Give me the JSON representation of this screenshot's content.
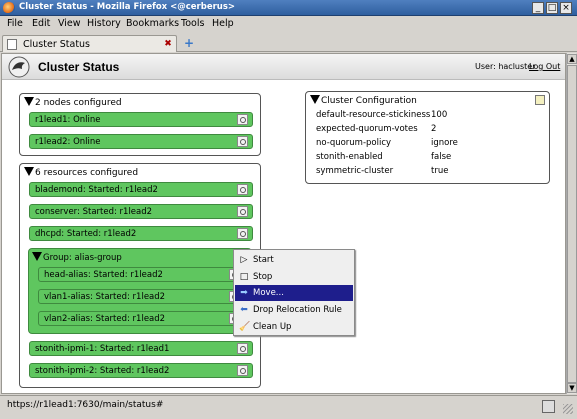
{
  "window": {
    "title": "Cluster Status - Mozilla Firefox <@cerberus>"
  },
  "menubar": {
    "items": [
      "File",
      "Edit",
      "View",
      "History",
      "Bookmarks",
      "Tools",
      "Help"
    ]
  },
  "tab": {
    "label": "Cluster Status",
    "new_tab_icon": "plus-icon"
  },
  "header": {
    "title": "Cluster Status",
    "user_text": "User: hacluster",
    "logout": "Log Out"
  },
  "nodes_panel": {
    "title": "2 nodes configured",
    "items": [
      {
        "label": "r1lead1: Online"
      },
      {
        "label": "r1lead2: Online"
      }
    ]
  },
  "resources_panel": {
    "title": "6 resources configured",
    "items": [
      {
        "label": "blademond: Started: r1lead2"
      },
      {
        "label": "conserver: Started: r1lead2"
      },
      {
        "label": "dhcpd: Started: r1lead2"
      }
    ],
    "group": {
      "title": "Group: alias-group",
      "items": [
        {
          "label": "head-alias: Started: r1lead2"
        },
        {
          "label": "vlan1-alias: Started: r1lead2"
        },
        {
          "label": "vlan2-alias: Started: r1lead2"
        }
      ]
    },
    "items_after": [
      {
        "label": "stonith-ipmi-1: Started: r1lead1"
      },
      {
        "label": "stonith-ipmi-2: Started: r1lead2"
      }
    ]
  },
  "config_panel": {
    "title": "Cluster Configuration",
    "rows": [
      {
        "key": "default-resource-stickiness",
        "value": "100"
      },
      {
        "key": "expected-quorum-votes",
        "value": "2"
      },
      {
        "key": "no-quorum-policy",
        "value": "ignore"
      },
      {
        "key": "stonith-enabled",
        "value": "false"
      },
      {
        "key": "symmetric-cluster",
        "value": "true"
      }
    ]
  },
  "context_menu": {
    "items": [
      {
        "label": "Start",
        "icon": "play-icon"
      },
      {
        "label": "Stop",
        "icon": "stop-icon"
      },
      {
        "label": "Move...",
        "icon": "arrow-right-icon",
        "selected": true
      },
      {
        "label": "Drop Relocation Rule",
        "icon": "arrow-left-icon"
      },
      {
        "label": "Clean Up",
        "icon": "broom-icon"
      }
    ]
  },
  "status_bar": {
    "text": "https://r1lead1:7630/main/status#"
  },
  "colors": {
    "resource_green": "#5fc65f",
    "menu_selected": "#1e1e8c",
    "titlebar": "#3f6faf"
  }
}
